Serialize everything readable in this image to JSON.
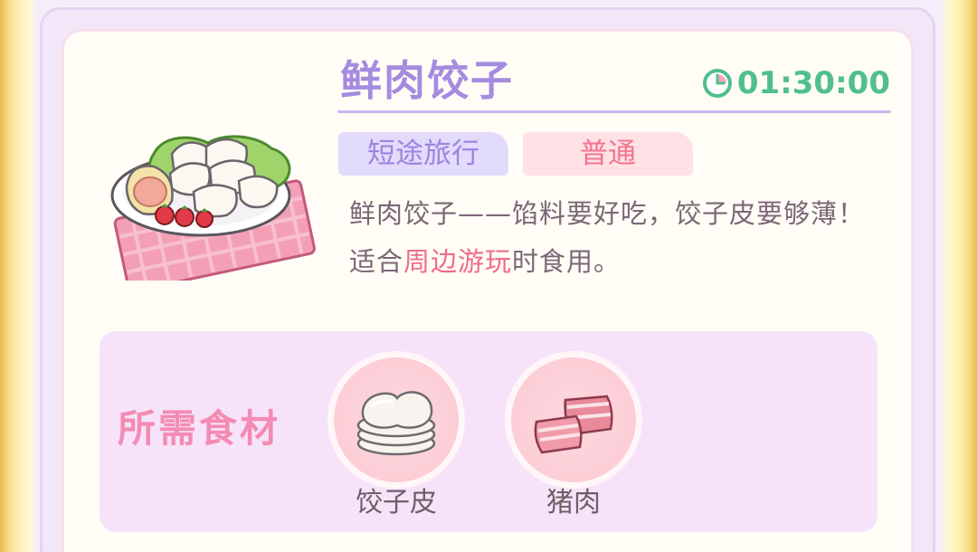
{
  "dish": {
    "name": "鲜肉饺子",
    "image_icon": "dumpling-plate-icon",
    "timer": "01:30:00",
    "timer_icon": "clock-icon"
  },
  "tags": {
    "travel_type": "短途旅行",
    "rarity": "普通"
  },
  "description": {
    "part1": "鲜肉饺子——馅料要好吃，饺子皮要够薄！适合",
    "highlight": "周边游玩",
    "part2": "时食用。"
  },
  "ingredients": {
    "title": "所需食材",
    "items": [
      {
        "label": "饺子皮",
        "icon": "dumpling-wrapper-icon"
      },
      {
        "label": "猪肉",
        "icon": "pork-icon"
      }
    ]
  },
  "colors": {
    "title": "#a58be0",
    "timer": "#4fbf8d",
    "highlight": "#f06b8e",
    "ingredients_title": "#f48bb2"
  }
}
